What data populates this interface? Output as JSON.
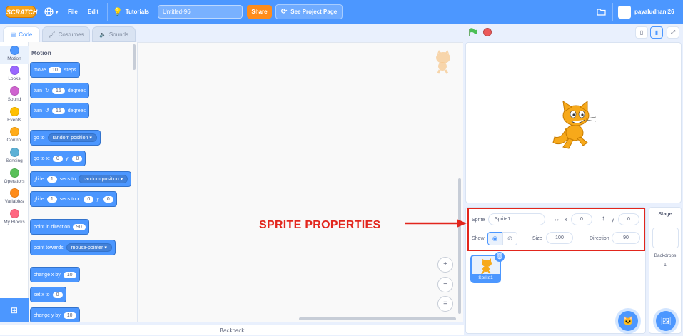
{
  "menubar": {
    "logo": "SCRATCH",
    "file": "File",
    "edit": "Edit",
    "tutorials": "Tutorials",
    "project_title": "Untitled-96",
    "share": "Share",
    "see_project_page": "See Project Page",
    "username": "payaludhani26"
  },
  "tabs": {
    "code": "Code",
    "costumes": "Costumes",
    "sounds": "Sounds"
  },
  "categories": [
    {
      "label": "Motion",
      "color": "#4c97ff"
    },
    {
      "label": "Looks",
      "color": "#9966ff"
    },
    {
      "label": "Sound",
      "color": "#cf63cf"
    },
    {
      "label": "Events",
      "color": "#ffbf00"
    },
    {
      "label": "Control",
      "color": "#ffab19"
    },
    {
      "label": "Sensing",
      "color": "#5cb1d6"
    },
    {
      "label": "Operators",
      "color": "#59c059"
    },
    {
      "label": "Variables",
      "color": "#ff8c1a"
    },
    {
      "label": "My Blocks",
      "color": "#ff6680"
    }
  ],
  "palette": {
    "title": "Motion",
    "move": {
      "a": "move",
      "v": "10",
      "b": "steps"
    },
    "turn_right": {
      "a": "turn",
      "v": "15",
      "b": "degrees"
    },
    "turn_left": {
      "a": "turn",
      "v": "15",
      "b": "degrees"
    },
    "goto": {
      "a": "go to",
      "d": "random position"
    },
    "gotoxy": {
      "a": "go to x:",
      "x": "0",
      "b": "y:",
      "y": "0"
    },
    "glide_to": {
      "a": "glide",
      "v": "1",
      "b": "secs to",
      "d": "random position"
    },
    "glide_xy": {
      "a": "glide",
      "v": "1",
      "b": "secs to x:",
      "x": "0",
      "c": "y:",
      "y": "0"
    },
    "point_dir": {
      "a": "point in direction",
      "v": "90"
    },
    "point_towards": {
      "a": "point towards",
      "d": "mouse-pointer"
    },
    "change_x": {
      "a": "change x by",
      "v": "10"
    },
    "set_x": {
      "a": "set x to",
      "v": "0"
    },
    "change_y": {
      "a": "change y by",
      "v": "10"
    }
  },
  "zoom": {
    "in": "+",
    "out": "−",
    "reset": "="
  },
  "backpack": "Backpack",
  "sprite_info": {
    "sprite_label": "Sprite",
    "sprite_name": "Sprite1",
    "x_label": "x",
    "x_value": "0",
    "y_label": "y",
    "y_value": "0",
    "show_label": "Show",
    "size_label": "Size",
    "size_value": "100",
    "direction_label": "Direction",
    "direction_value": "90"
  },
  "annotation": "SPRITE PROPERTIES",
  "sprite_list": [
    {
      "name": "Sprite1"
    }
  ],
  "stage_pane": {
    "title": "Stage",
    "backdrops_label": "Backdrops",
    "backdrops_count": "1"
  },
  "colors": {
    "accent": "#4c97ff",
    "share": "#ff8c1a",
    "annotation": "#e2261d"
  }
}
